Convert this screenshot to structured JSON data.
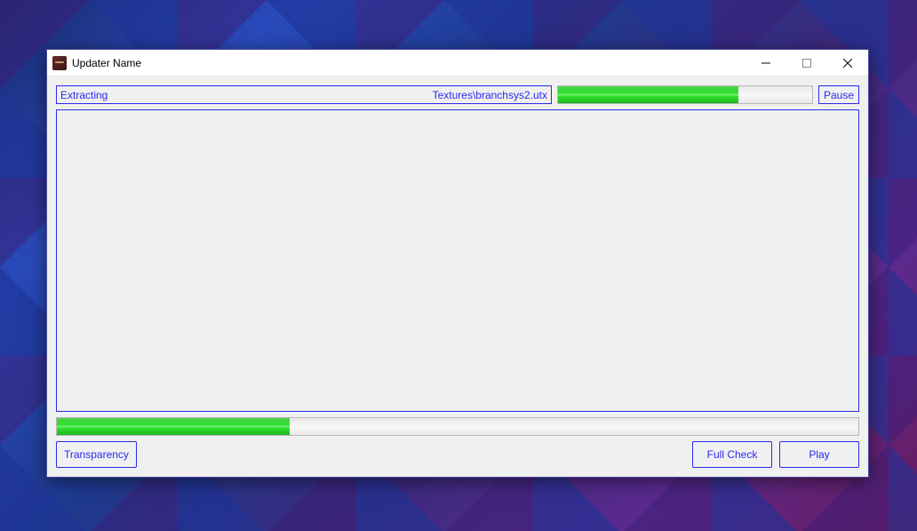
{
  "window": {
    "title": "Updater Name"
  },
  "status": {
    "action": "Extracting",
    "file": "Textures\\branchsys2.utx"
  },
  "progress": {
    "file_percent": 71,
    "overall_percent": 29
  },
  "buttons": {
    "pause": "Pause",
    "transparency": "Transparency",
    "full_check": "Full Check",
    "play": "Play"
  },
  "colors": {
    "accent": "#2a2aee",
    "progress_green": "#2ee02e"
  }
}
